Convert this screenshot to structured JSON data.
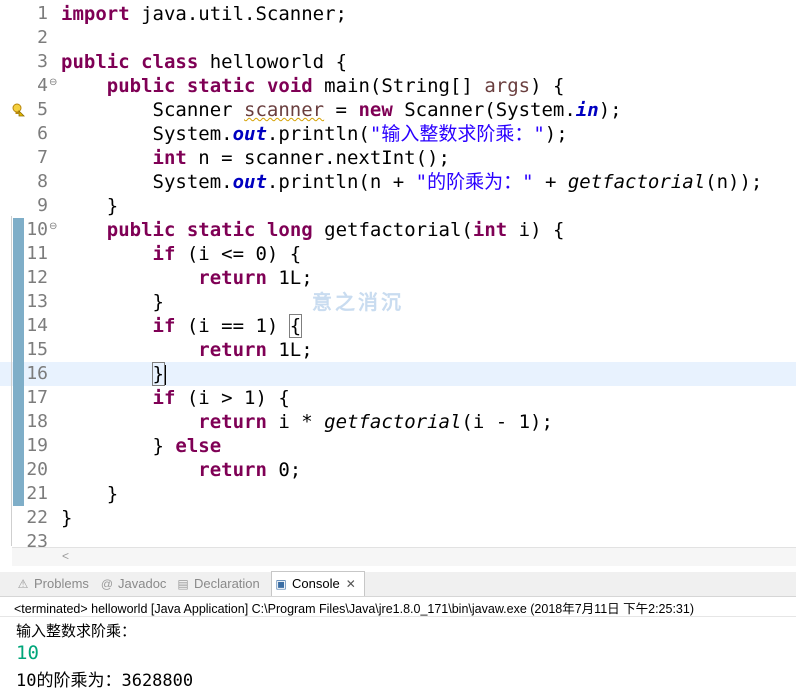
{
  "editor": {
    "lines": [
      {
        "n": "1",
        "fold": "",
        "marker": "",
        "tokens": [
          {
            "c": "kw",
            "t": "import"
          },
          {
            "c": "",
            "t": " java.util.Scanner;"
          }
        ]
      },
      {
        "n": "2",
        "fold": "",
        "marker": "",
        "tokens": []
      },
      {
        "n": "3",
        "fold": "",
        "marker": "",
        "tokens": [
          {
            "c": "kw",
            "t": "public"
          },
          {
            "c": "",
            "t": " "
          },
          {
            "c": "kw",
            "t": "class"
          },
          {
            "c": "",
            "t": " helloworld {"
          }
        ]
      },
      {
        "n": "4",
        "fold": "⊖",
        "marker": "",
        "tokens": [
          {
            "c": "",
            "t": "    "
          },
          {
            "c": "kw",
            "t": "public"
          },
          {
            "c": "",
            "t": " "
          },
          {
            "c": "kw",
            "t": "static"
          },
          {
            "c": "",
            "t": " "
          },
          {
            "c": "kw",
            "t": "void"
          },
          {
            "c": "",
            "t": " main(String[] "
          },
          {
            "c": "var",
            "t": "args"
          },
          {
            "c": "",
            "t": ") {"
          }
        ]
      },
      {
        "n": "5",
        "fold": "",
        "marker": "warning",
        "tokens": [
          {
            "c": "",
            "t": "        Scanner "
          },
          {
            "c": "warnvar",
            "t": "scanner"
          },
          {
            "c": "",
            "t": " = "
          },
          {
            "c": "kw",
            "t": "new"
          },
          {
            "c": "",
            "t": " Scanner(System."
          },
          {
            "c": "fld",
            "t": "in"
          },
          {
            "c": "",
            "t": ");"
          }
        ]
      },
      {
        "n": "6",
        "fold": "",
        "marker": "",
        "tokens": [
          {
            "c": "",
            "t": "        System."
          },
          {
            "c": "fld",
            "t": "out"
          },
          {
            "c": "",
            "t": ".println("
          },
          {
            "c": "str",
            "t": "\"输入整数求阶乘：\""
          },
          {
            "c": "",
            "t": ");"
          }
        ]
      },
      {
        "n": "7",
        "fold": "",
        "marker": "",
        "tokens": [
          {
            "c": "",
            "t": "        "
          },
          {
            "c": "kw",
            "t": "int"
          },
          {
            "c": "",
            "t": " n = scanner.nextInt();"
          }
        ]
      },
      {
        "n": "8",
        "fold": "",
        "marker": "",
        "tokens": [
          {
            "c": "",
            "t": "        System."
          },
          {
            "c": "fld",
            "t": "out"
          },
          {
            "c": "",
            "t": ".println(n + "
          },
          {
            "c": "str",
            "t": "\"的阶乘为：\""
          },
          {
            "c": "",
            "t": " + "
          },
          {
            "c": "mth",
            "t": "getfactorial"
          },
          {
            "c": "",
            "t": "(n));"
          }
        ]
      },
      {
        "n": "9",
        "fold": "",
        "marker": "",
        "tokens": [
          {
            "c": "",
            "t": "    }"
          }
        ]
      },
      {
        "n": "10",
        "fold": "⊖",
        "marker": "change",
        "tokens": [
          {
            "c": "",
            "t": "    "
          },
          {
            "c": "kw",
            "t": "public"
          },
          {
            "c": "",
            "t": " "
          },
          {
            "c": "kw",
            "t": "static"
          },
          {
            "c": "",
            "t": " "
          },
          {
            "c": "kw",
            "t": "long"
          },
          {
            "c": "",
            "t": " getfactorial("
          },
          {
            "c": "kw",
            "t": "int"
          },
          {
            "c": "",
            "t": " i) {"
          }
        ]
      },
      {
        "n": "11",
        "fold": "",
        "marker": "change",
        "tokens": [
          {
            "c": "",
            "t": "        "
          },
          {
            "c": "kw",
            "t": "if"
          },
          {
            "c": "",
            "t": " (i <= 0) {"
          }
        ]
      },
      {
        "n": "12",
        "fold": "",
        "marker": "change",
        "tokens": [
          {
            "c": "",
            "t": "            "
          },
          {
            "c": "kw",
            "t": "return"
          },
          {
            "c": "",
            "t": " 1L;"
          }
        ]
      },
      {
        "n": "13",
        "fold": "",
        "marker": "change",
        "tokens": [
          {
            "c": "",
            "t": "        }"
          }
        ]
      },
      {
        "n": "14",
        "fold": "",
        "marker": "change",
        "tokens": [
          {
            "c": "",
            "t": "        "
          },
          {
            "c": "kw",
            "t": "if"
          },
          {
            "c": "",
            "t": " (i == 1) "
          },
          {
            "c": "bracket-box",
            "t": "{"
          }
        ]
      },
      {
        "n": "15",
        "fold": "",
        "marker": "change",
        "tokens": [
          {
            "c": "",
            "t": "            "
          },
          {
            "c": "kw",
            "t": "return"
          },
          {
            "c": "",
            "t": " 1L;"
          }
        ]
      },
      {
        "n": "16",
        "fold": "",
        "marker": "change",
        "current": true,
        "tokens": [
          {
            "c": "",
            "t": "        "
          },
          {
            "c": "bracket-box",
            "t": "}"
          },
          {
            "c": "caret",
            "t": ""
          }
        ]
      },
      {
        "n": "17",
        "fold": "",
        "marker": "change",
        "tokens": [
          {
            "c": "",
            "t": "        "
          },
          {
            "c": "kw",
            "t": "if"
          },
          {
            "c": "",
            "t": " (i > 1) {"
          }
        ]
      },
      {
        "n": "18",
        "fold": "",
        "marker": "change",
        "tokens": [
          {
            "c": "",
            "t": "            "
          },
          {
            "c": "kw",
            "t": "return"
          },
          {
            "c": "",
            "t": " i * "
          },
          {
            "c": "mth",
            "t": "getfactorial"
          },
          {
            "c": "",
            "t": "(i - 1);"
          }
        ]
      },
      {
        "n": "19",
        "fold": "",
        "marker": "change",
        "tokens": [
          {
            "c": "",
            "t": "        } "
          },
          {
            "c": "kw",
            "t": "else"
          }
        ]
      },
      {
        "n": "20",
        "fold": "",
        "marker": "change",
        "tokens": [
          {
            "c": "",
            "t": "            "
          },
          {
            "c": "kw",
            "t": "return"
          },
          {
            "c": "",
            "t": " 0;"
          }
        ]
      },
      {
        "n": "21",
        "fold": "",
        "marker": "change",
        "tokens": [
          {
            "c": "",
            "t": "    }"
          }
        ]
      },
      {
        "n": "22",
        "fold": "",
        "marker": "",
        "tokens": [
          {
            "c": "",
            "t": "}"
          }
        ]
      },
      {
        "n": "23",
        "fold": "",
        "marker": "",
        "tokens": []
      }
    ],
    "watermark": "意之消沉"
  },
  "tabs": [
    {
      "label": "Problems",
      "icon": "problems-icon",
      "glyph": "⚠",
      "active": false
    },
    {
      "label": "Javadoc",
      "icon": "javadoc-icon",
      "glyph": "@",
      "active": false
    },
    {
      "label": "Declaration",
      "icon": "declaration-icon",
      "glyph": "▤",
      "active": false
    },
    {
      "label": "Console",
      "icon": "console-icon",
      "glyph": "▣",
      "active": true,
      "close": "✕"
    }
  ],
  "console": {
    "status": "<terminated> helloworld [Java Application] C:\\Program Files\\Java\\jre1.8.0_171\\bin\\javaw.exe (2018年7月11日 下午2:25:31)",
    "prompt": "输入整数求阶乘：",
    "input": "10",
    "result": "10的阶乘为：3628800"
  },
  "colors": {
    "keyword": "#7f0055",
    "string": "#2a00ff",
    "field": "#0000c0",
    "console_input": "#00a67a",
    "current_line": "#e8f2fe"
  }
}
